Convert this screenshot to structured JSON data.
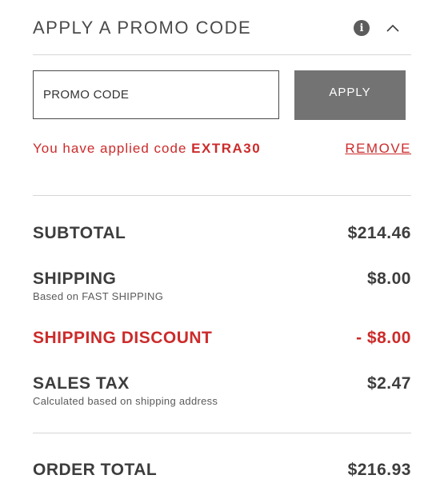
{
  "promo": {
    "title": "APPLY A PROMO CODE",
    "info_icon": "info-icon",
    "toggle_icon": "chevron-up-icon",
    "input_placeholder": "PROMO CODE",
    "input_value": "",
    "apply_label": "APPLY",
    "applied_prefix": "You have applied code",
    "applied_code": "EXTRA30",
    "remove_label": "REMOVE"
  },
  "summary": {
    "subtotal_label": "SUBTOTAL",
    "subtotal_value": "$214.46",
    "shipping_label": "SHIPPING",
    "shipping_sub": "Based on FAST SHIPPING",
    "shipping_value": "$8.00",
    "discount_label": "SHIPPING DISCOUNT",
    "discount_value": "- $8.00",
    "tax_label": "SALES TAX",
    "tax_sub": "Calculated based on shipping address",
    "tax_value": "$2.47",
    "total_label": "ORDER TOTAL",
    "total_value": "$216.93"
  },
  "colors": {
    "accent_red": "#cc2b2b",
    "button_gray": "#737373",
    "text_dark": "#3d3d3d"
  }
}
